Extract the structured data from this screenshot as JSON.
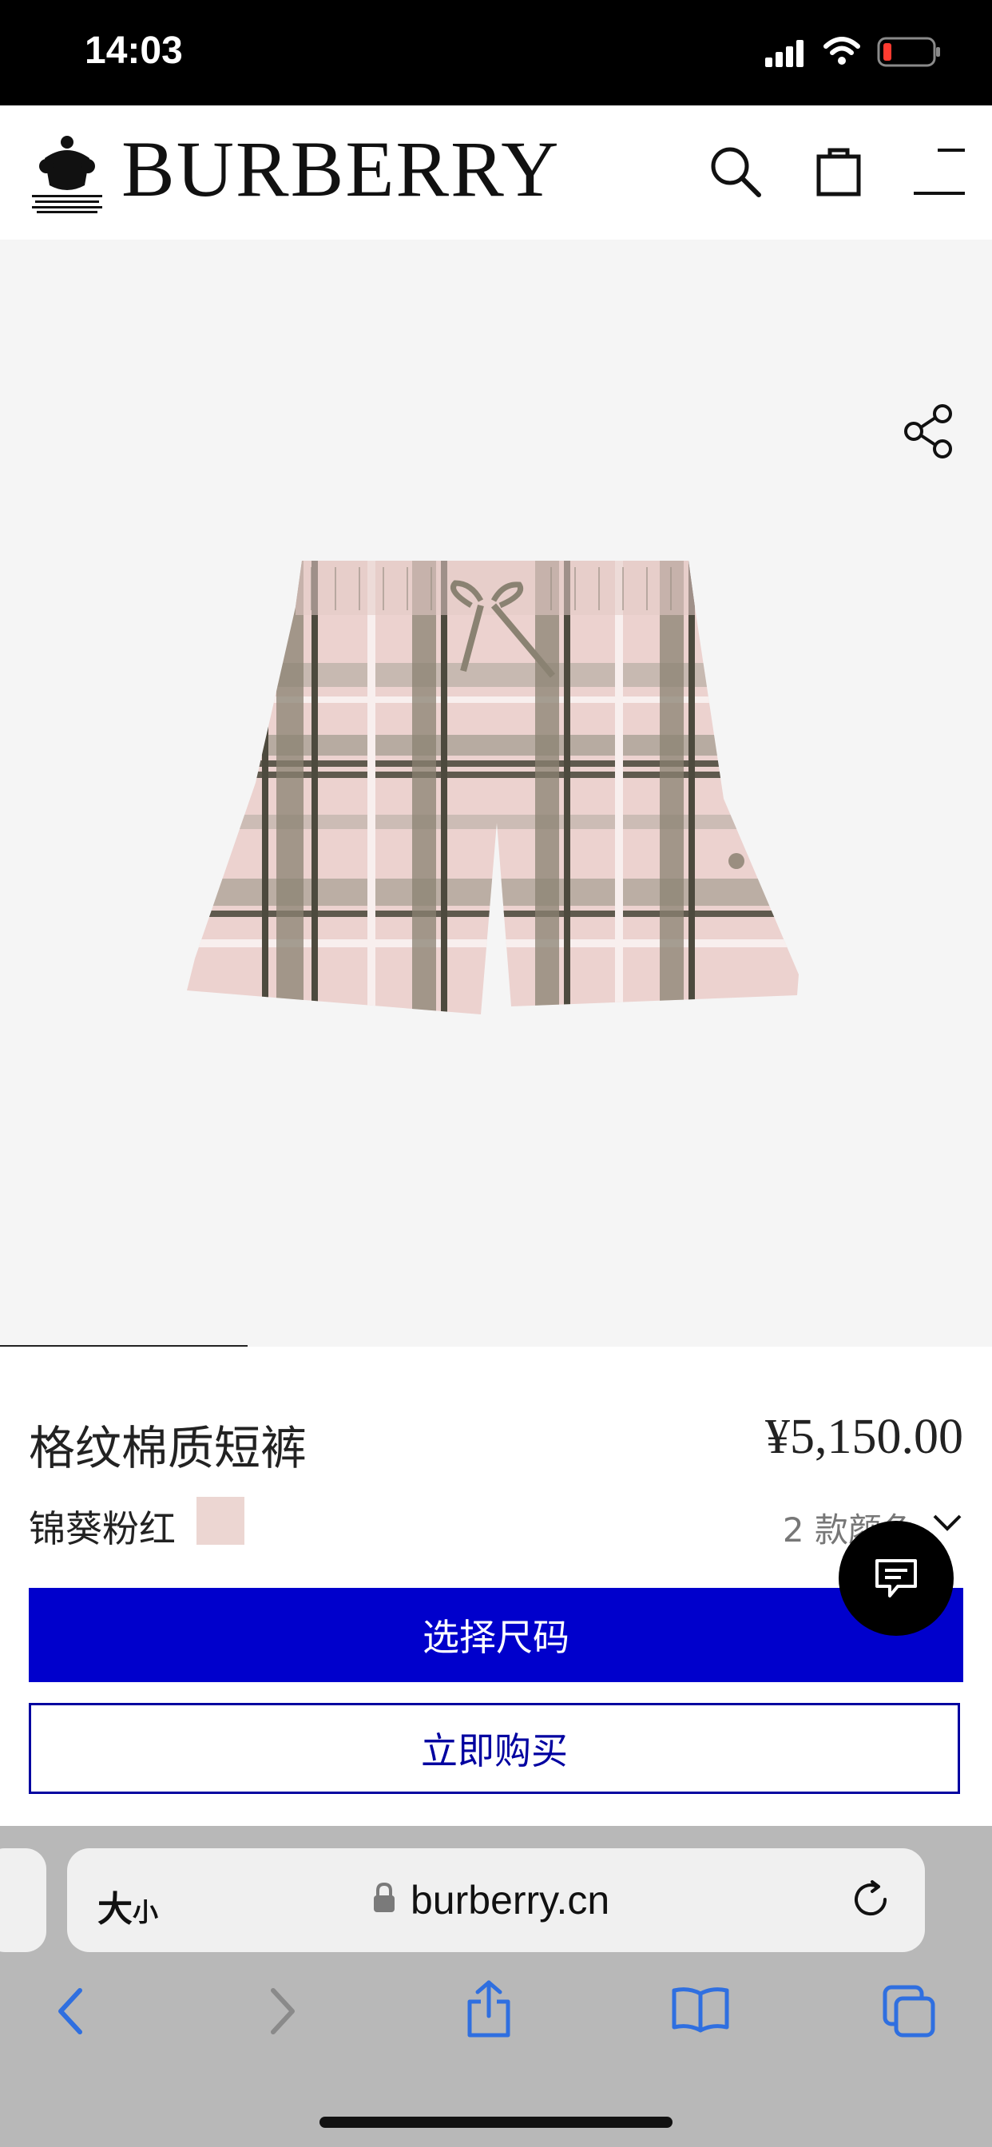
{
  "status_bar": {
    "time": "14:03"
  },
  "header": {
    "brand": "BURBERRY"
  },
  "product": {
    "name": "格纹棉质短裤",
    "price": "¥5,150.00",
    "color_name": "锦葵粉红",
    "swatch_color": "#ecd6d2",
    "color_count": "2 款颜色",
    "select_size_label": "选择尺码",
    "buy_now_label": "立即购买"
  },
  "browser": {
    "text_size_big": "大",
    "text_size_small": "小",
    "url": "burberry.cn"
  },
  "colors": {
    "accent": "#0000cc",
    "outline": "#0000a0"
  }
}
